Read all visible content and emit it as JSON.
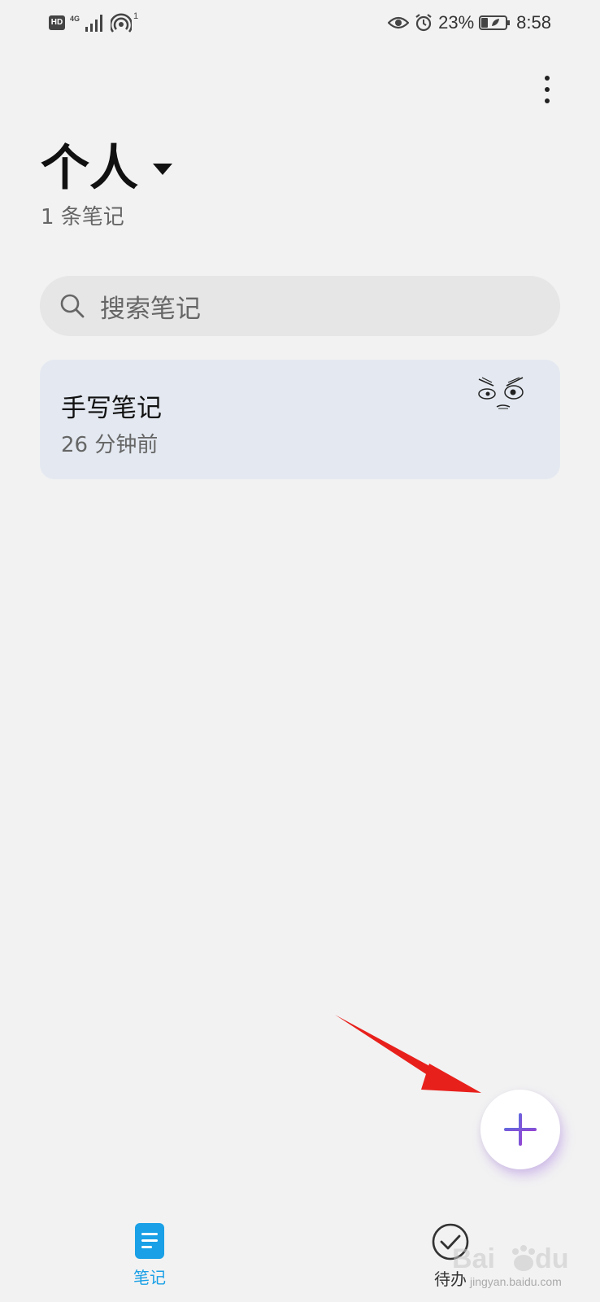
{
  "status_bar": {
    "hd_badge": "HD",
    "network_type": "4G",
    "hotspot_count": "1",
    "battery_percent": "23%",
    "time": "8:58"
  },
  "header": {
    "folder_name": "个人",
    "note_count": "1 条笔记"
  },
  "search": {
    "placeholder": "搜索笔记"
  },
  "notes": [
    {
      "title": "手写笔记",
      "time": "26 分钟前"
    }
  ],
  "bottom_nav": {
    "tabs": [
      {
        "label": "笔记",
        "active": true
      },
      {
        "label": "待办",
        "active": false
      }
    ]
  },
  "watermark": {
    "text": "jingyan.baidu.com"
  },
  "colors": {
    "accent": "#1aa0e6",
    "fab_plus": "#7b4fd6",
    "annotation_arrow": "#e8201c",
    "card_bg": "#e4e9f1"
  }
}
